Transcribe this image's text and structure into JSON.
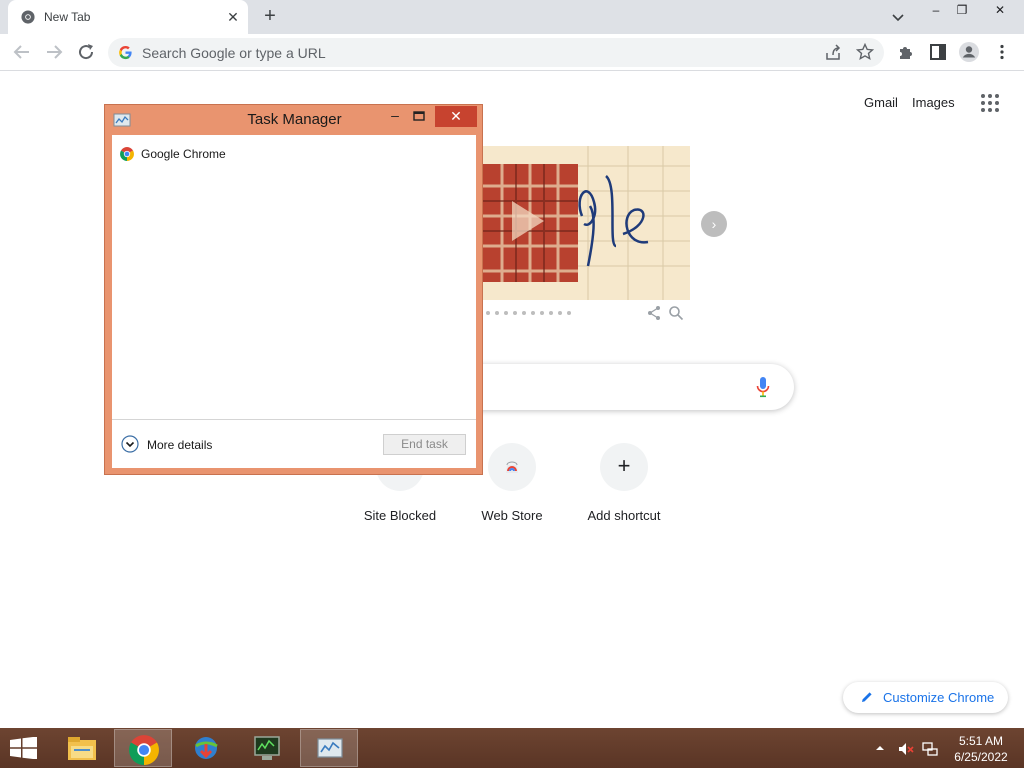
{
  "browser": {
    "tab": {
      "title": "New Tab",
      "favicon": "chrome-icon"
    },
    "new_tab_symbol": "+",
    "close_symbol": "✕",
    "window_controls": {
      "minimize": "–",
      "restore": "❐",
      "close": "✕"
    },
    "omnibox": {
      "placeholder": "Search Google or type a URL"
    }
  },
  "ntp": {
    "top_links": {
      "gmail": "Gmail",
      "images": "Images"
    },
    "doodle": {
      "next_symbol": "›"
    },
    "shortcuts": [
      {
        "label": "Site Blocked",
        "icon": "site-blocked-icon"
      },
      {
        "label": "Web Store",
        "icon": "web-store-icon"
      },
      {
        "label": "Add shortcut",
        "icon": "plus-icon"
      }
    ],
    "add_symbol": "+",
    "customize_label": "Customize Chrome"
  },
  "task_manager": {
    "title": "Task Manager",
    "minimize_symbol": "–",
    "close_symbol": "✕",
    "processes": [
      {
        "name": "Google Chrome",
        "icon": "chrome-icon"
      }
    ],
    "more_details_label": "More details",
    "end_task_label": "End task"
  },
  "taskbar": {
    "items": [
      "file-explorer-icon",
      "chrome-icon",
      "internet-download-manager-icon",
      "terminal-app-icon",
      "task-manager-icon"
    ],
    "clock": {
      "time": "5:51 AM",
      "date": "6/25/2022"
    }
  },
  "colors": {
    "tabstrip": "#dee1e6",
    "taskmgr_frame": "#e9946f",
    "taskmgr_close": "#c7432f",
    "taskbar": "#5a3525",
    "link_blue": "#1a73e8"
  }
}
